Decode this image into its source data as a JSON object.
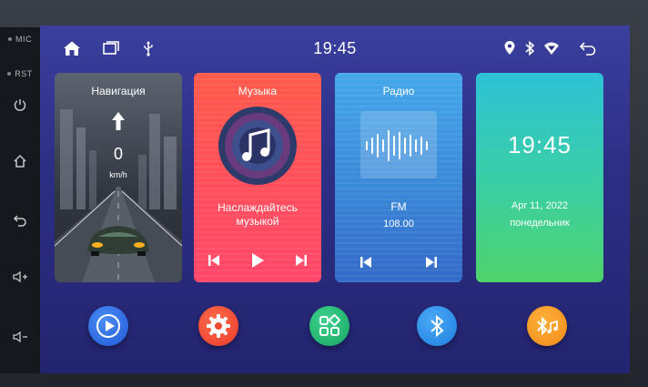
{
  "hardware": {
    "mic_label": "MIC",
    "rst_label": "RST"
  },
  "status_bar": {
    "time": "19:45",
    "left_icons": [
      "home-icon",
      "recent-apps-icon",
      "usb-icon"
    ],
    "right_icons": [
      "location-icon",
      "bluetooth-icon",
      "wifi-icon",
      "back-icon"
    ]
  },
  "cards": {
    "navigation": {
      "title": "Навигация",
      "speed": "0",
      "unit": "km/h"
    },
    "music": {
      "title": "Музыка",
      "subtitle_line1": "Наслаждайтесь",
      "subtitle_line2": "музыкой"
    },
    "radio": {
      "title": "Радио",
      "band": "FM",
      "frequency": "108.00"
    },
    "clock": {
      "time": "19:45",
      "date": "Apr 11, 2022",
      "weekday": "понедельник"
    }
  },
  "dock": [
    "play-icon",
    "settings-icon",
    "apps-icon",
    "bluetooth-icon",
    "bluetooth-music-icon"
  ],
  "colors": {
    "screen_bg": "#2d2f86",
    "music_card": "#ff5058",
    "radio_card": "#3a88d8",
    "clock_card": "#3bcfa3"
  }
}
